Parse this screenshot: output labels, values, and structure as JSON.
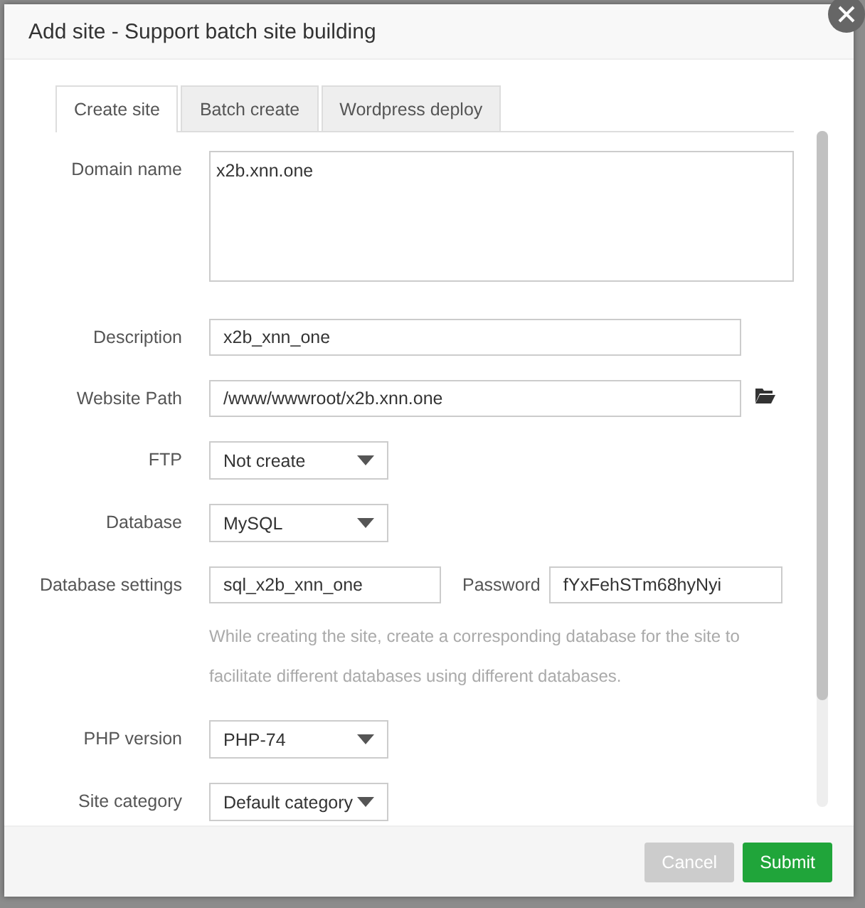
{
  "dialog": {
    "title": "Add site - Support batch site building",
    "tabs": [
      {
        "label": "Create site",
        "selected": true
      },
      {
        "label": "Batch create",
        "selected": false
      },
      {
        "label": "Wordpress deploy",
        "selected": false
      }
    ],
    "fields": [
      {
        "kind": "textarea",
        "label": "Domain name",
        "value": "x2b.xnn.one"
      },
      {
        "kind": "text",
        "label": "Description",
        "value": "x2b_xnn_one"
      },
      {
        "kind": "path",
        "label": "Website Path",
        "value": "/www/wwwroot/x2b.xnn.one"
      },
      {
        "kind": "select",
        "label": "FTP",
        "value": "Not create"
      },
      {
        "kind": "select",
        "label": "Database",
        "value": "MySQL"
      },
      {
        "kind": "pair",
        "label": "Database settings",
        "value": "sql_x2b_xnn_one",
        "second_label": "Password",
        "second_value": "fYxFehSTm68hyNyi",
        "hint": "While creating the site, create a corresponding database for the site to facilitate different databases using different databases."
      },
      {
        "kind": "select",
        "label": "PHP version",
        "value": "PHP-74"
      },
      {
        "kind": "select",
        "label": "Site category",
        "value": "Default category"
      }
    ],
    "buttons": [
      {
        "kind": "cancel",
        "label": "Cancel"
      },
      {
        "kind": "submit",
        "label": "Submit"
      }
    ]
  }
}
